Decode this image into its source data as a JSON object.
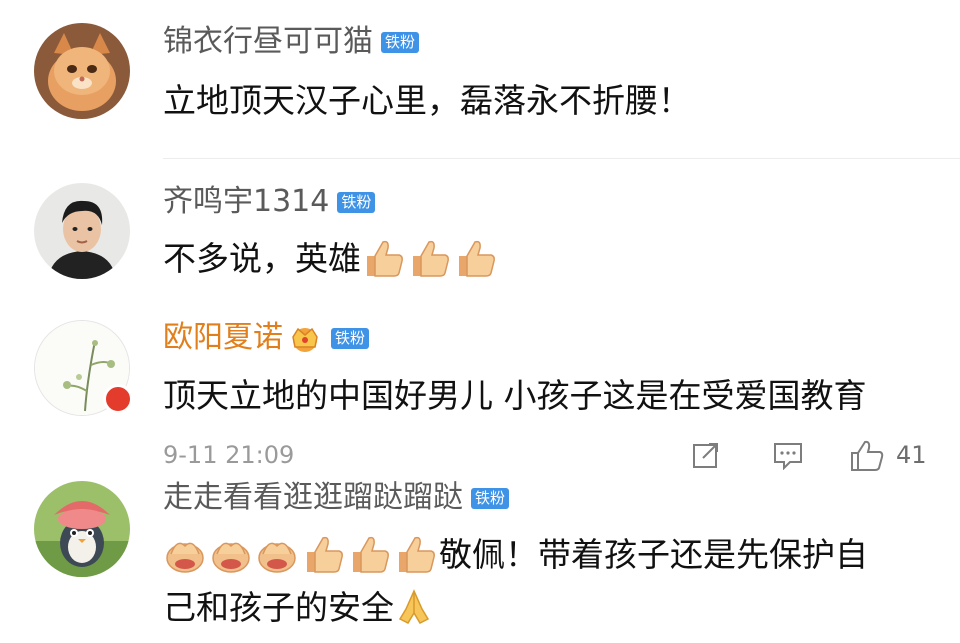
{
  "badge_label": "铁粉",
  "comments": [
    {
      "username": "锦衣行昼可可猫",
      "text": "立地顶天汉子心里，磊落永不折腰！"
    },
    {
      "username": "齐鸣宇1314",
      "text": "不多说，英雄"
    },
    {
      "username": "欧阳夏诺",
      "text": "顶天立地的中国好男儿 小孩子这是在受爱国教育",
      "timestamp": "9-11 21:09",
      "like_count": "41"
    },
    {
      "username": "走走看看逛逛蹓跶蹓跶",
      "text_line1": "敬佩！带着孩子还是先保护自",
      "text_line2": "己和孩子的安全"
    }
  ],
  "colors": {
    "badge": "#3f93e6",
    "vip_name": "#e07f1c",
    "username": "#5a5a5a",
    "text": "#111111"
  }
}
